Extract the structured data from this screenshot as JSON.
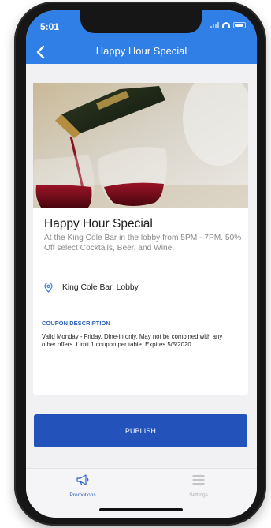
{
  "status": {
    "time": "5:01"
  },
  "header": {
    "title": "Happy Hour Special"
  },
  "card": {
    "title": "Happy Hour Special",
    "description": "At the King Cole Bar in the lobby from 5PM - 7PM. 50% Off select Cocktails, Beer, and Wine.",
    "location": "King Cole Bar, Lobby",
    "coupon_heading": "COUPON DESCRIPTION",
    "coupon_text": "Valid Monday - Friday. Dine-in only. May not be combined with any other offers. Limit 1 coupon per table. Expires 5/5/2020."
  },
  "actions": {
    "publish_label": "PUBLISH"
  },
  "tabs": [
    {
      "label": "Promotions",
      "icon": "megaphone-icon",
      "active": true
    },
    {
      "label": "Settings",
      "icon": "menu-icon",
      "active": false
    }
  ],
  "colors": {
    "header": "#2f7fe6",
    "publish": "#2352bb",
    "accent": "#2f62c4"
  }
}
